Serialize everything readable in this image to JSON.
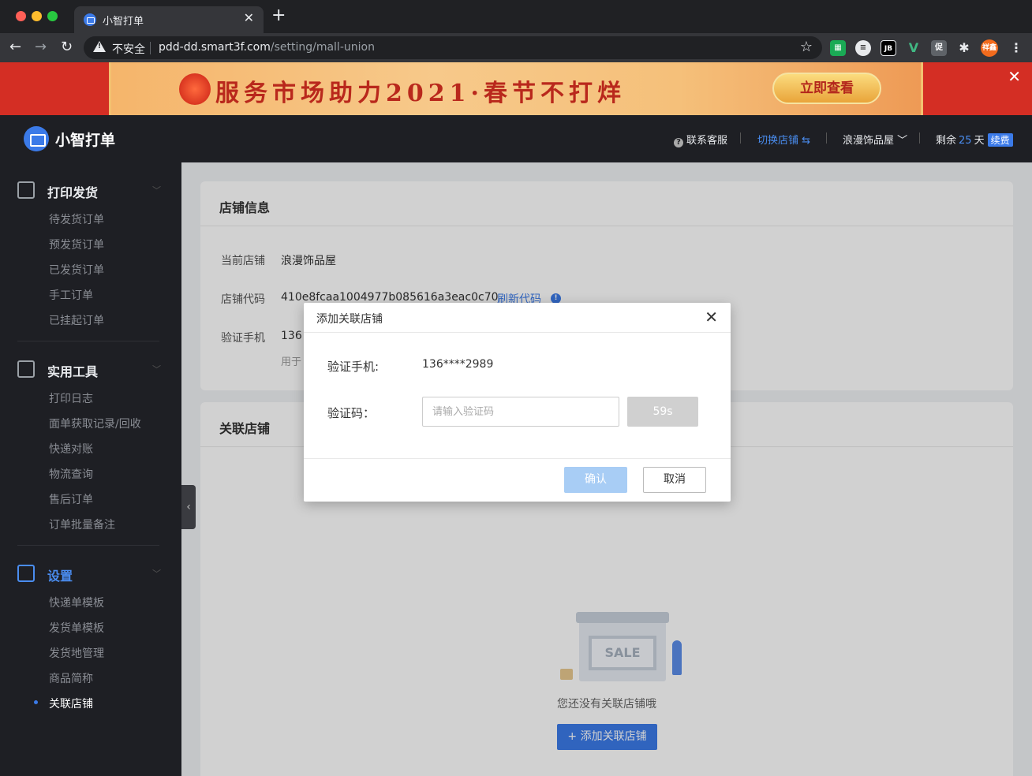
{
  "browser": {
    "tab_title": "小智打单",
    "insecure_label": "不安全",
    "url_host": "pdd-dd.smart3f.com",
    "url_path": "/setting/mall-union",
    "ext_jb": "JB",
    "ext_cu": "促",
    "ext_avatar": "祥鑫"
  },
  "promo": {
    "text": "服务市场助力2021·春节不打烊",
    "button_label": "立即查看"
  },
  "header": {
    "app_name": "小智打单",
    "help_label": "联系客服",
    "switch_store_label": "切换店铺 ⇆",
    "store_name": "浪漫饰品屋",
    "remain_prefix": "剩余",
    "remain_days": "25",
    "remain_unit": "天",
    "renew_label": "续费"
  },
  "sidebar": {
    "groups": [
      {
        "title": "打印发货",
        "items": [
          "待发货订单",
          "预发货订单",
          "已发货订单",
          "手工订单",
          "已挂起订单"
        ]
      },
      {
        "title": "实用工具",
        "items": [
          "打印日志",
          "面单获取记录/回收",
          "快递对账",
          "物流查询",
          "售后订单",
          "订单批量备注"
        ]
      },
      {
        "title": "设置",
        "items": [
          "快递单模板",
          "发货单模板",
          "发货地管理",
          "商品简称",
          "关联店铺"
        ]
      }
    ]
  },
  "store_info": {
    "title": "店铺信息",
    "current_store_label": "当前店铺",
    "current_store_value": "浪漫饰品屋",
    "store_code_label": "店铺代码",
    "store_code_value": "410e8fcaa1004977b085616a3eac0c70",
    "refresh_code_label": "刷新代码",
    "verify_phone_label": "验证手机",
    "verify_phone_value": "136",
    "verify_phone_hint": "用于"
  },
  "union": {
    "title": "关联店铺",
    "empty_text": "您还没有关联店铺哦",
    "add_button_label": "+ 添加关联店铺",
    "sale_text": "SALE"
  },
  "modal": {
    "title": "添加关联店铺",
    "phone_label": "验证手机:",
    "phone_value": "136****2989",
    "code_label": "验证码：",
    "code_placeholder": "请输入验证码",
    "code_value": "",
    "countdown_label": "59s",
    "confirm_label": "确认",
    "cancel_label": "取消"
  },
  "colors": {
    "accent": "#3b7ae8",
    "sidebar_bg": "#1e1f24",
    "promo_red": "#d42e24"
  }
}
